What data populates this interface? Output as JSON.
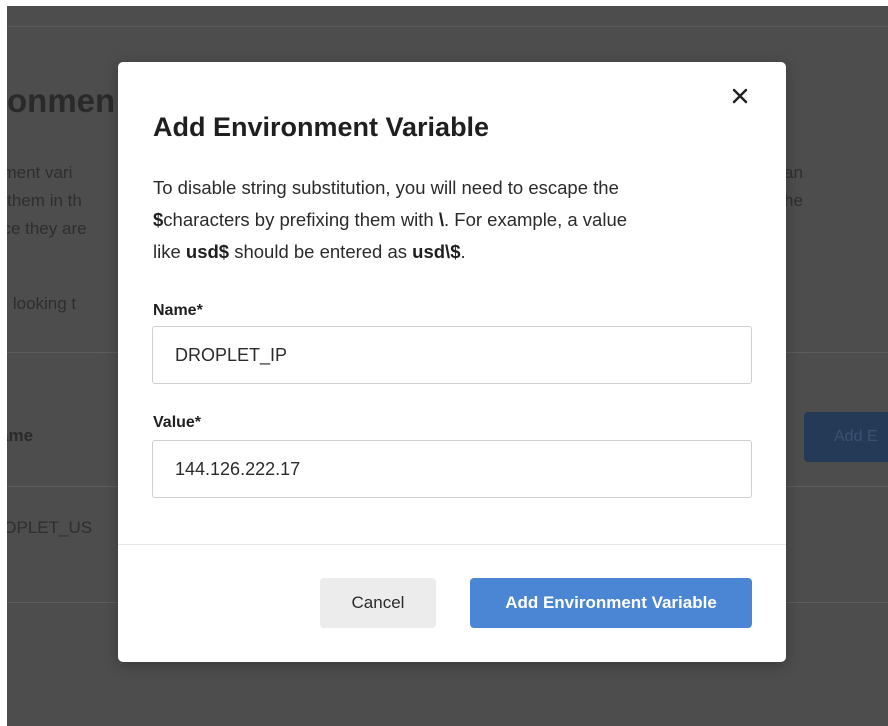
{
  "background": {
    "title_fragment": "ironmen",
    "paragraph_fragments": [
      "nment vari",
      "g them in th",
      "nce they are"
    ],
    "right_fragments": [
      "an",
      "he"
    ],
    "looking_fragment": "re looking t",
    "table_header_fragment": "ame",
    "add_button_fragment": "Add E",
    "row_fragment": "ROPLET_US"
  },
  "modal": {
    "title": "Add Environment Variable",
    "description": {
      "line1": "To disable string substitution, you will need to escape the",
      "dollar_bold": "$",
      "line2_rest": "characters by prefixing them with ",
      "backslash_bold": "\\",
      "line2_end": ". For example, a value",
      "line3_start": "like ",
      "example_bold": "usd$",
      "line3_mid": " should be entered as ",
      "escaped_bold": "usd\\$",
      "line3_end": "."
    },
    "name_field": {
      "label": "Name*",
      "value": "DROPLET_IP"
    },
    "value_field": {
      "label": "Value*",
      "value": "144.126.222.17"
    },
    "cancel_label": "Cancel",
    "submit_label": "Add Environment Variable",
    "close_icon": "close-icon"
  },
  "colors": {
    "overlay": "#4d4d4d",
    "primary_button": "#4a86d4",
    "cancel_button": "#ececec",
    "background_button": "#253a57"
  }
}
